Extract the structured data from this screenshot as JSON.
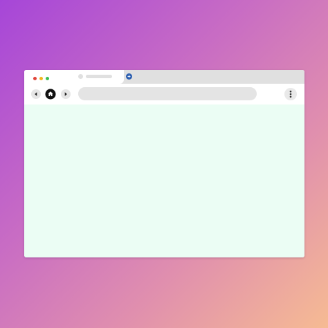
{
  "colors": {
    "background_gradient": [
      "#a646d8",
      "#c86cc4",
      "#e08fae",
      "#f6bb93"
    ],
    "window_frame": "#ffffff",
    "tab_strip": "#e0e0e0",
    "close_dot": "#e0443a",
    "minimize_dot": "#f2b51e",
    "maximize_dot": "#3cbe56",
    "new_tab_button": "#2d5fb0",
    "address_bar": "#e4e4e4",
    "content_area": "#ebfdf4"
  },
  "window_controls": {
    "close": {
      "icon": "close-dot-icon",
      "color": "#e0443a"
    },
    "minimize": {
      "icon": "minimize-dot-icon",
      "color": "#f2b51e"
    },
    "maximize": {
      "icon": "maximize-dot-icon",
      "color": "#3cbe56"
    }
  },
  "tabs": {
    "active_tab": {
      "title": "",
      "favicon": "favicon-placeholder"
    },
    "new_tab_icon": "plus-icon",
    "new_tab_glyph": "+"
  },
  "toolbar": {
    "back_icon": "chevron-left-icon",
    "home_icon": "home-icon",
    "forward_icon": "chevron-right-icon",
    "address_value": "",
    "address_placeholder": "",
    "menu_icon": "vertical-dots-icon"
  },
  "content": {
    "text": ""
  }
}
